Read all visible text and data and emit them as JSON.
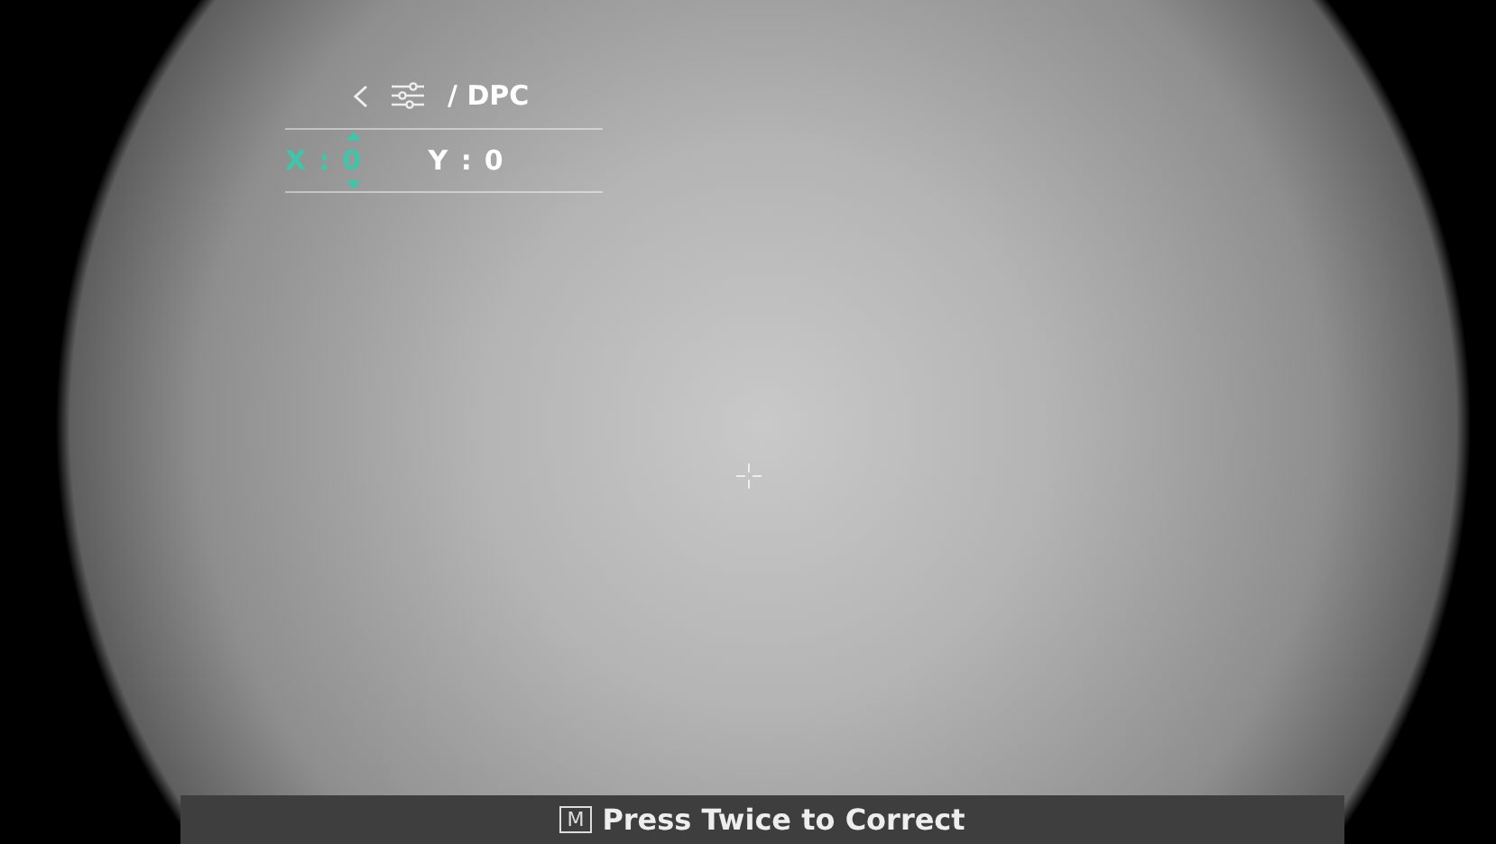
{
  "menu": {
    "title": "/ DPC"
  },
  "offsets": [
    {
      "label": "X :",
      "value": "0",
      "selected": true
    },
    {
      "label": "Y :",
      "value": "0",
      "selected": false
    }
  ],
  "hint_bar": {
    "key": "M",
    "text": "Press Twice to Correct"
  }
}
